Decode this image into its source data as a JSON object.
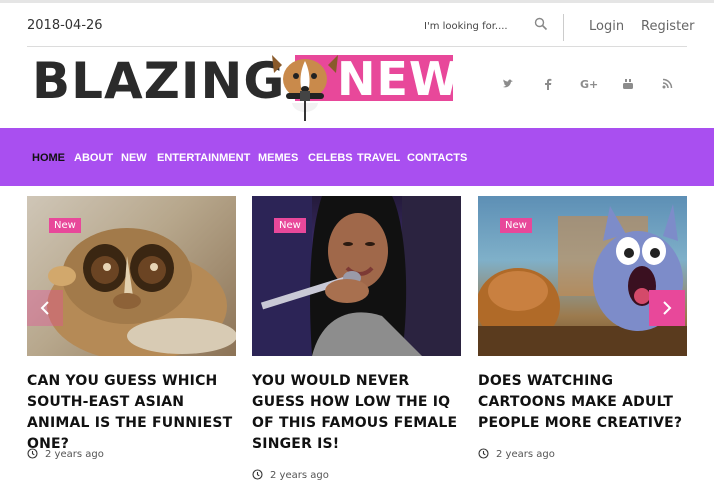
{
  "topbar": {
    "date": "2018-04-26",
    "search_placeholder": "I'm looking for....",
    "login": "Login",
    "register": "Register"
  },
  "logo": {
    "part1": "BLAZING",
    "part2": "NEWS"
  },
  "social": [
    "twitter-icon",
    "facebook-icon",
    "google-plus-icon",
    "youtube-icon",
    "rss-icon"
  ],
  "nav": {
    "items": [
      "HOME",
      "ABOUT",
      "NEW",
      "ENTERTAINMENT",
      "MEMES",
      "CELEBS",
      "TRAVEL",
      "CONTACTS"
    ],
    "active_index": 0
  },
  "cards": [
    {
      "badge": "New",
      "title": "CAN YOU GUESS WHICH SOUTH-EAST ASIAN ANIMAL IS THE FUNNIEST ONE?",
      "time": "2 years ago"
    },
    {
      "badge": "New",
      "title": "YOU WOULD NEVER GUESS HOW LOW THE IQ OF THIS FAMOUS FEMALE SINGER IS!",
      "time": "2 years ago"
    },
    {
      "badge": "New",
      "title": "DOES WATCHING CARTOONS MAKE ADULT PEOPLE MORE CREATIVE?",
      "time": "2 years ago"
    }
  ],
  "colors": {
    "accent_pink": "#e8489a",
    "nav_purple": "#a94ff0"
  }
}
